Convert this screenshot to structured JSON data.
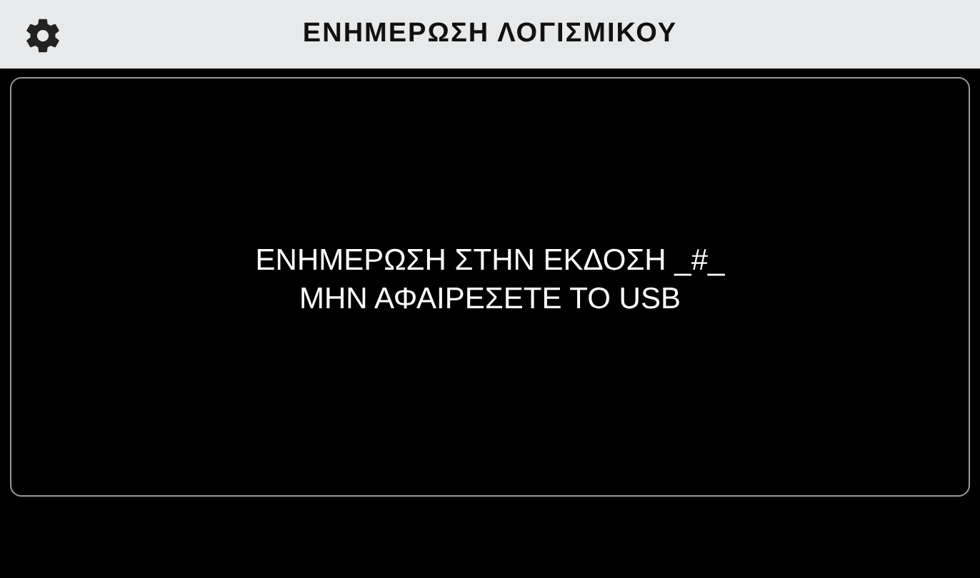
{
  "header": {
    "title": "ΕΝΗΜΕΡΩΣΗ ΛΟΓΙΣΜΙΚΟΥ"
  },
  "message": {
    "lines": [
      "ΕΝΗΜΕΡΩΣΗ ΣΤΗΝ ΕΚΔΟΣΗ _#_",
      "ΜΗΝ ΑΦΑΙΡΕΣΕΤΕ ΤΟ USB"
    ]
  }
}
